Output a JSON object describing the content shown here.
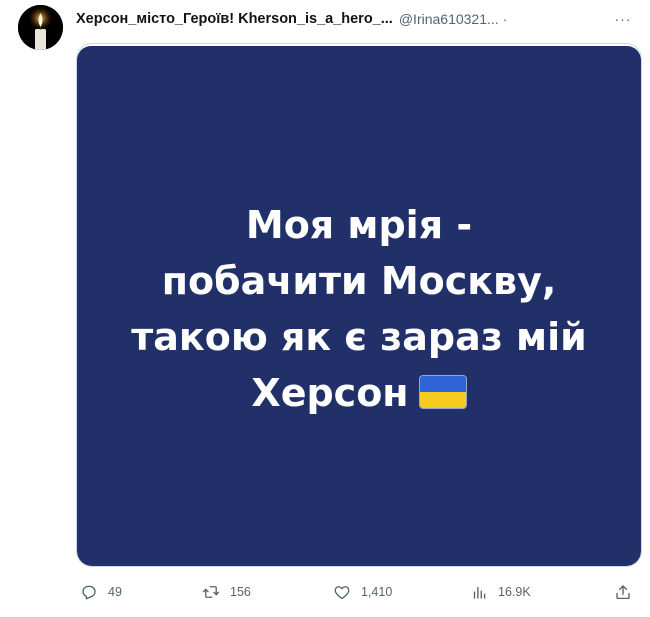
{
  "tweet": {
    "author": {
      "display_name": "Херсон_місто_Героїв! Kherson_is_a_hero_...",
      "handle": "@Irina610321...",
      "separator": "·"
    },
    "more_label": "···",
    "image": {
      "lines": [
        "Моя мрія -",
        "побачити Москву,",
        "такою як є зараз мій",
        "Херсон"
      ],
      "flag_emoji": "ukraine-flag",
      "background_color": "#213068"
    },
    "stats": {
      "replies": "49",
      "retweets": "156",
      "likes": "1,410",
      "views": "16.9K"
    },
    "icons": {
      "reply": "reply-icon",
      "retweet": "retweet-icon",
      "like": "heart-icon",
      "views": "views-icon",
      "share": "share-icon"
    }
  }
}
